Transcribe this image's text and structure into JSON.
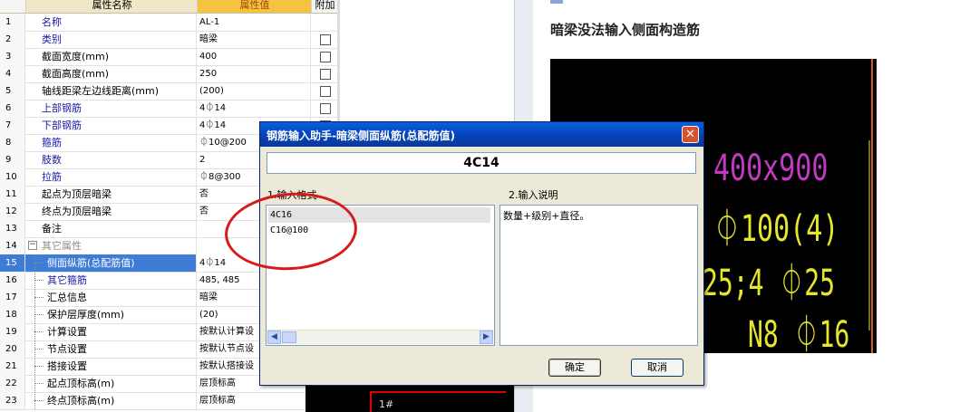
{
  "grid": {
    "headers": {
      "name": "属性名称",
      "value": "属性值",
      "attach": "附加"
    },
    "rows": [
      {
        "num": "1",
        "name": "名称",
        "value": "AL-1",
        "style": "blue",
        "checkbox": false
      },
      {
        "num": "2",
        "name": "类别",
        "value": "暗梁",
        "style": "blue",
        "checkbox": true
      },
      {
        "num": "3",
        "name": "截面宽度(mm)",
        "value": "400",
        "style": "",
        "checkbox": true
      },
      {
        "num": "4",
        "name": "截面高度(mm)",
        "value": "250",
        "style": "",
        "checkbox": true
      },
      {
        "num": "5",
        "name": "轴线距梁左边线距离(mm)",
        "value": "(200)",
        "style": "",
        "checkbox": true
      },
      {
        "num": "6",
        "name": "上部钢筋",
        "value": "4⏀14",
        "style": "blue",
        "checkbox": true
      },
      {
        "num": "7",
        "name": "下部钢筋",
        "value": "4⏀14",
        "style": "blue",
        "checkbox": true
      },
      {
        "num": "8",
        "name": "箍筋",
        "value": "⏀10@200",
        "style": "blue",
        "checkbox": false
      },
      {
        "num": "9",
        "name": "肢数",
        "value": "2",
        "style": "blue",
        "checkbox": false
      },
      {
        "num": "10",
        "name": "拉筋",
        "value": "⏀8@300",
        "style": "blue",
        "checkbox": false
      },
      {
        "num": "11",
        "name": "起点为顶层暗梁",
        "value": "否",
        "style": "",
        "checkbox": false
      },
      {
        "num": "12",
        "name": "终点为顶层暗梁",
        "value": "否",
        "style": "",
        "checkbox": false
      },
      {
        "num": "13",
        "name": "备注",
        "value": "",
        "style": "",
        "checkbox": false
      },
      {
        "num": "14",
        "name": "其它属性",
        "value": "",
        "style": "gray",
        "checkbox": false
      },
      {
        "num": "15",
        "name": "侧面纵筋(总配筋值)",
        "value": "4⏀14",
        "style": "",
        "checkbox": false
      },
      {
        "num": "16",
        "name": "其它箍筋",
        "value": "485, 485",
        "style": "blue",
        "checkbox": false
      },
      {
        "num": "17",
        "name": "汇总信息",
        "value": "暗梁",
        "style": "",
        "checkbox": false
      },
      {
        "num": "18",
        "name": "保护层厚度(mm)",
        "value": "(20)",
        "style": "",
        "checkbox": false
      },
      {
        "num": "19",
        "name": "计算设置",
        "value": "按默认计算设",
        "style": "",
        "checkbox": false
      },
      {
        "num": "20",
        "name": "节点设置",
        "value": "按默认节点设",
        "style": "",
        "checkbox": false
      },
      {
        "num": "21",
        "name": "搭接设置",
        "value": "按默认搭接设",
        "style": "",
        "checkbox": false
      },
      {
        "num": "22",
        "name": "起点顶标高(m)",
        "value": "层顶标高",
        "style": "",
        "checkbox": false
      },
      {
        "num": "23",
        "name": "终点顶标高(m)",
        "value": "层顶标高",
        "style": "",
        "checkbox": false
      }
    ],
    "selected_row": "15",
    "collapse_glyph": "−"
  },
  "article": {
    "title": "暗梁没法输入侧面构造筋"
  },
  "cad": {
    "lines": [
      "400x900",
      "⏀100(4)",
      "25;4 ⏀25",
      "N8 ⏀16"
    ],
    "colors": {
      "magenta": "#c23ac2",
      "yellow": "#e6e62c"
    },
    "lower_label": "1#"
  },
  "dialog": {
    "title": "钢筋输入助手-暗梁侧面纵筋(总配筋值)",
    "close_glyph": "✕",
    "formula_value": "4C14",
    "format_label": "1.输入格式",
    "desc_label": "2.输入说明",
    "formats": [
      "4C16",
      "C16@100"
    ],
    "description": "数量+级别+直径。",
    "ok_label": "确定",
    "cancel_label": "取消",
    "scroll_left": "◀",
    "scroll_right": "▶"
  },
  "colors": {
    "selection": "#3f7cd6",
    "title_bar": "#0442b8",
    "annotation": "#d91a1a"
  }
}
